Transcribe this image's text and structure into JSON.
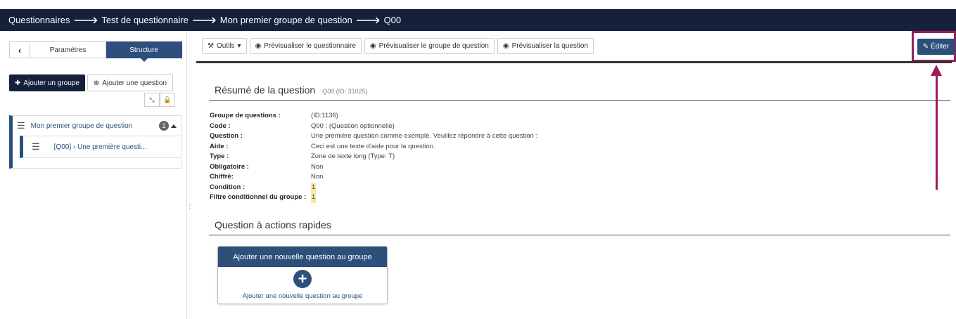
{
  "breadcrumb": [
    "Questionnaires",
    "Test de questionnaire",
    "Mon premier groupe de question",
    "Q00"
  ],
  "sidebar": {
    "back_label": "‹",
    "tabs": [
      {
        "label": "Paramètres",
        "active": false
      },
      {
        "label": "Structure",
        "active": true
      }
    ],
    "add_group_label": "Ajouter un groupe",
    "add_question_label": "Ajouter une question",
    "group": {
      "label": "Mon premier groupe de question",
      "count": "1"
    },
    "question": {
      "label": "[Q00] › Une première questi..."
    }
  },
  "toolbar": {
    "tools_label": "Outils",
    "preview_survey_label": "Prévisualiser le questionnaire",
    "preview_group_label": "Prévisualiser le groupe de question",
    "preview_question_label": "Prévisualiser la question",
    "edit_label": "Éditer"
  },
  "summary": {
    "title": "Résumé de la question",
    "code_small": "Q00",
    "id_small": "(ID: 31025)",
    "rows": [
      {
        "label": "Groupe de questions :",
        "value": "(ID:1136)",
        "highlight": false
      },
      {
        "label": "Code :",
        "value": "Q00 : (Question optionnelle)",
        "highlight": false
      },
      {
        "label": "Question :",
        "value": "Une première question comme exemple. Veuillez répondre à cette question :",
        "highlight": false
      },
      {
        "label": "Aide :",
        "value": "Ceci est une texte d'aide pour la question.",
        "highlight": false
      },
      {
        "label": "Type :",
        "value": "Zone de texte long (Type: T)",
        "highlight": false
      },
      {
        "label": "Obligatoire :",
        "value": "Non",
        "highlight": false
      },
      {
        "label": "Chiffré:",
        "value": "Non",
        "highlight": false
      },
      {
        "label": "Condition :",
        "value": "1",
        "highlight": true
      },
      {
        "label": "Filtre conditionnel du groupe :",
        "value": "1",
        "highlight": true
      }
    ]
  },
  "quick_actions": {
    "title": "Question à actions rapides",
    "card_title": "Ajouter une nouvelle question au groupe",
    "card_text": "Ajouter une nouvelle question au groupe"
  },
  "colors": {
    "navbar": "#15213a",
    "primary": "#2c4f7c",
    "annotation": "#9b1c5a"
  }
}
